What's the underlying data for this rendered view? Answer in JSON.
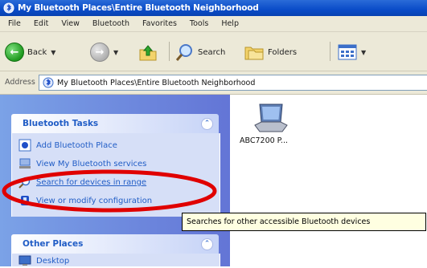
{
  "window": {
    "title": "My Bluetooth Places\\Entire Bluetooth Neighborhood"
  },
  "menu": [
    "File",
    "Edit",
    "View",
    "Bluetooth",
    "Favorites",
    "Tools",
    "Help"
  ],
  "toolbar": {
    "back": "Back",
    "search": "Search",
    "folders": "Folders"
  },
  "address": {
    "label": "Address",
    "value": "My Bluetooth Places\\Entire Bluetooth Neighborhood"
  },
  "bluetooth_tasks": {
    "title": "Bluetooth Tasks",
    "items": [
      {
        "label": "Add Bluetooth Place",
        "icon": "add-place-icon"
      },
      {
        "label": "View My Bluetooth services",
        "icon": "services-icon"
      },
      {
        "label": "Search for devices in range",
        "icon": "search-icon"
      },
      {
        "label": "View or modify configuration",
        "icon": "config-icon"
      }
    ]
  },
  "other_places": {
    "title": "Other Places",
    "items": [
      {
        "label": "Desktop",
        "icon": "desktop-icon"
      }
    ]
  },
  "device": {
    "label": "ABC7200 P..."
  },
  "tooltip": {
    "text": "Searches for other accessible Bluetooth devices"
  },
  "colors": {
    "title_bar": "#0a4cc8",
    "task_link": "#215dc6",
    "annotation": "#e00000"
  }
}
